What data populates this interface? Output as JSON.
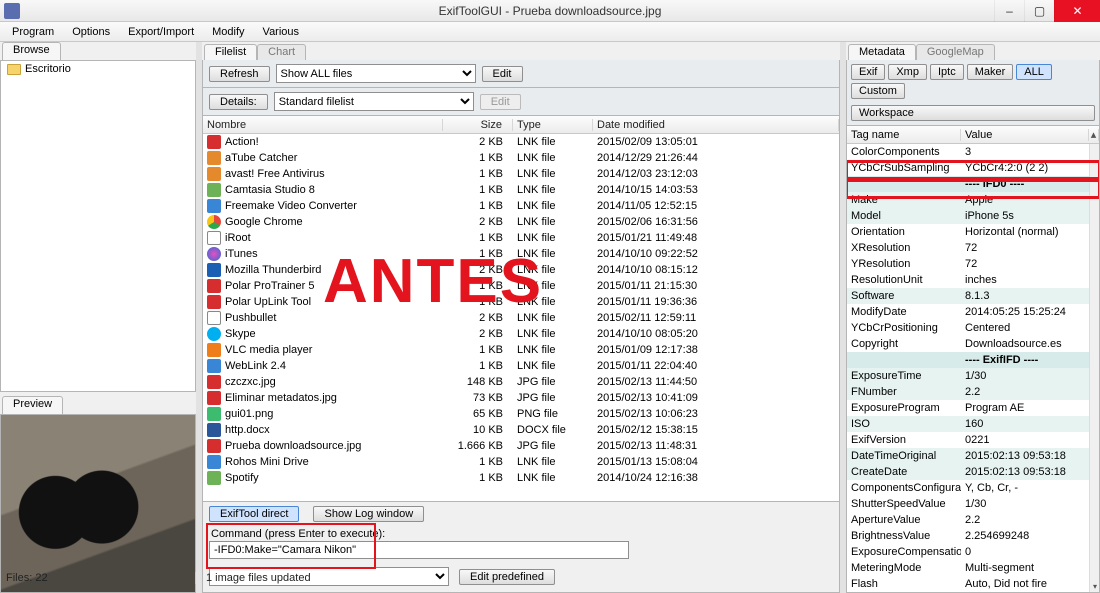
{
  "title": "ExifToolGUI - Prueba downloadsource.jpg",
  "menus": [
    "Program",
    "Options",
    "Export/Import",
    "Modify",
    "Various"
  ],
  "left": {
    "browse_tab": "Browse",
    "preview_tab": "Preview",
    "tree": {
      "root": "Escritorio"
    }
  },
  "center": {
    "tabs": {
      "filelist": "Filelist",
      "chart": "Chart"
    },
    "toolbar": {
      "refresh": "Refresh",
      "show_filter": "Show ALL files",
      "edit1": "Edit",
      "details": "Details:",
      "filelist_sel": "Standard filelist",
      "edit2": "Edit"
    },
    "columns": {
      "name": "Nombre",
      "size": "Size",
      "type": "Type",
      "date": "Date modified"
    },
    "rows": [
      {
        "icon": "fi-red",
        "name": "Action!",
        "size": "2 KB",
        "type": "LNK file",
        "date": "2015/02/09 13:05:01"
      },
      {
        "icon": "fi-orange",
        "name": "aTube Catcher",
        "size": "1 KB",
        "type": "LNK file",
        "date": "2014/12/29 21:26:44"
      },
      {
        "icon": "fi-orange",
        "name": "avast! Free Antivirus",
        "size": "1 KB",
        "type": "LNK file",
        "date": "2014/12/03 23:12:03"
      },
      {
        "icon": "fi-app",
        "name": "Camtasia Studio 8",
        "size": "1 KB",
        "type": "LNK file",
        "date": "2014/10/15 14:03:53"
      },
      {
        "icon": "fi-blue",
        "name": "Freemake Video Converter",
        "size": "1 KB",
        "type": "LNK file",
        "date": "2014/11/05 12:52:15"
      },
      {
        "icon": "fi-chrome",
        "name": "Google Chrome",
        "size": "2 KB",
        "type": "LNK file",
        "date": "2015/02/06 16:31:56"
      },
      {
        "icon": "fi-gear",
        "name": "iRoot",
        "size": "1 KB",
        "type": "LNK file",
        "date": "2015/01/21 11:49:48"
      },
      {
        "icon": "fi-itunes",
        "name": "iTunes",
        "size": "1 KB",
        "type": "LNK file",
        "date": "2014/10/10 09:22:52"
      },
      {
        "icon": "fi-tbird",
        "name": "Mozilla Thunderbird",
        "size": "2 KB",
        "type": "LNK file",
        "date": "2014/10/10 08:15:12"
      },
      {
        "icon": "fi-red",
        "name": "Polar ProTrainer 5",
        "size": "1 KB",
        "type": "LNK file",
        "date": "2015/01/11 21:15:30"
      },
      {
        "icon": "fi-red",
        "name": "Polar UpLink Tool",
        "size": "1 KB",
        "type": "LNK file",
        "date": "2015/01/11 19:36:36"
      },
      {
        "icon": "fi-gear",
        "name": "Pushbullet",
        "size": "2 KB",
        "type": "LNK file",
        "date": "2015/02/11 12:59:11"
      },
      {
        "icon": "fi-skype",
        "name": "Skype",
        "size": "2 KB",
        "type": "LNK file",
        "date": "2014/10/10 08:05:20"
      },
      {
        "icon": "fi-vlc",
        "name": "VLC media player",
        "size": "1 KB",
        "type": "LNK file",
        "date": "2015/01/09 12:17:38"
      },
      {
        "icon": "fi-blue",
        "name": "WebLink 2.4",
        "size": "1 KB",
        "type": "LNK file",
        "date": "2015/01/11 22:04:40"
      },
      {
        "icon": "fi-red",
        "name": "czczxc.jpg",
        "size": "148 KB",
        "type": "JPG file",
        "date": "2015/02/13 11:44:50"
      },
      {
        "icon": "fi-red",
        "name": "Eliminar metadatos.jpg",
        "size": "73 KB",
        "type": "JPG file",
        "date": "2015/02/13 10:41:09"
      },
      {
        "icon": "fi-png",
        "name": "gui01.png",
        "size": "65 KB",
        "type": "PNG file",
        "date": "2015/02/13 10:06:23"
      },
      {
        "icon": "fi-docx",
        "name": "http.docx",
        "size": "10 KB",
        "type": "DOCX file",
        "date": "2015/02/12 15:38:15"
      },
      {
        "icon": "fi-red",
        "name": "Prueba downloadsource.jpg",
        "size": "1.666 KB",
        "type": "JPG file",
        "date": "2015/02/13 11:48:31"
      },
      {
        "icon": "fi-blue",
        "name": "Rohos Mini Drive",
        "size": "1 KB",
        "type": "LNK file",
        "date": "2015/01/13 15:08:04"
      },
      {
        "icon": "fi-app",
        "name": "Spotify",
        "size": "1 KB",
        "type": "LNK file",
        "date": "2014/10/24 12:16:38"
      }
    ],
    "overlay": "ANTES",
    "direct": {
      "exiftool_direct": "ExifTool direct",
      "show_log": "Show Log window",
      "label": "Command (press Enter to execute):",
      "value": "-IFD0:Make=\"Camara Nikon\"",
      "edit_predef": "Edit predefined"
    }
  },
  "right": {
    "tabs": {
      "metadata": "Metadata",
      "googlemap": "GoogleMap"
    },
    "buttons": {
      "exif": "Exif",
      "xmp": "Xmp",
      "iptc": "Iptc",
      "maker": "Maker",
      "all": "ALL",
      "custom": "Custom",
      "workspace": "Workspace"
    },
    "columns": {
      "tag": "Tag name",
      "value": "Value"
    },
    "rows": [
      {
        "tag": "ColorComponents",
        "val": "3",
        "shade": false
      },
      {
        "tag": "YCbCrSubSampling",
        "val": "YCbCr4:2:0 (2 2)",
        "shade": false
      },
      {
        "tag": "",
        "val": "---- IFD0 ----",
        "shade": true,
        "section": true
      },
      {
        "tag": "Make",
        "val": "Apple",
        "shade": true
      },
      {
        "tag": "Model",
        "val": "iPhone 5s",
        "shade": true
      },
      {
        "tag": "Orientation",
        "val": "Horizontal (normal)",
        "shade": false
      },
      {
        "tag": "XResolution",
        "val": "72",
        "shade": false
      },
      {
        "tag": "YResolution",
        "val": "72",
        "shade": false
      },
      {
        "tag": "ResolutionUnit",
        "val": "inches",
        "shade": false
      },
      {
        "tag": "Software",
        "val": "8.1.3",
        "shade": true
      },
      {
        "tag": "ModifyDate",
        "val": "2014:05:25 15:25:24",
        "shade": false
      },
      {
        "tag": "YCbCrPositioning",
        "val": "Centered",
        "shade": false
      },
      {
        "tag": "Copyright",
        "val": "Downloadsource.es",
        "shade": false
      },
      {
        "tag": "",
        "val": "---- ExifIFD ----",
        "shade": true,
        "section": true
      },
      {
        "tag": "ExposureTime",
        "val": "1/30",
        "shade": true
      },
      {
        "tag": "FNumber",
        "val": "2.2",
        "shade": true
      },
      {
        "tag": "ExposureProgram",
        "val": "Program AE",
        "shade": false
      },
      {
        "tag": "ISO",
        "val": "160",
        "shade": true
      },
      {
        "tag": "ExifVersion",
        "val": "0221",
        "shade": false
      },
      {
        "tag": "DateTimeOriginal",
        "val": "2015:02:13 09:53:18",
        "shade": true
      },
      {
        "tag": "CreateDate",
        "val": "2015:02:13 09:53:18",
        "shade": true
      },
      {
        "tag": "ComponentsConfiguration",
        "val": "Y, Cb, Cr, -",
        "shade": false
      },
      {
        "tag": "ShutterSpeedValue",
        "val": "1/30",
        "shade": false
      },
      {
        "tag": "ApertureValue",
        "val": "2.2",
        "shade": false
      },
      {
        "tag": "BrightnessValue",
        "val": "2.254699248",
        "shade": false
      },
      {
        "tag": "ExposureCompensation",
        "val": "0",
        "shade": false
      },
      {
        "tag": "MeteringMode",
        "val": "Multi-segment",
        "shade": false
      },
      {
        "tag": "Flash",
        "val": "Auto, Did not fire",
        "shade": false
      }
    ]
  },
  "status": {
    "files": "Files: 22",
    "msg": "1 image files updated"
  },
  "winbtns": {
    "min": "–",
    "max": "▢",
    "close": "✕"
  }
}
